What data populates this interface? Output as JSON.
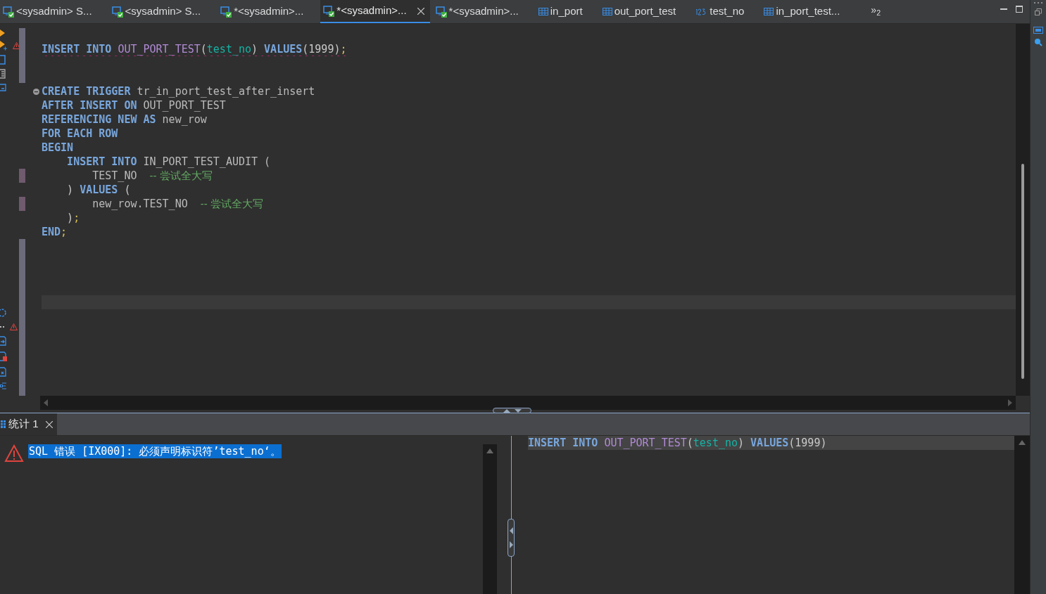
{
  "tabs": [
    {
      "label": "<sysadmin> S...",
      "kind": "script",
      "selected": false
    },
    {
      "label": "<sysadmin> S...",
      "kind": "script",
      "selected": false
    },
    {
      "label": "*<sysadmin>...",
      "kind": "script",
      "selected": false
    },
    {
      "label": "*<sysadmin>...",
      "kind": "script",
      "selected": true
    },
    {
      "label": "*<sysadmin>...",
      "kind": "script",
      "selected": false
    },
    {
      "label": "in_port",
      "kind": "table",
      "selected": false
    },
    {
      "label": "out_port_test",
      "kind": "table",
      "selected": false
    },
    {
      "label": "test_no",
      "kind": "column",
      "selected": false
    },
    {
      "label": "in_port_test...",
      "kind": "table",
      "selected": false
    }
  ],
  "overflow": "»$_{2}$",
  "editor": {
    "cursor_line_highlight": true,
    "lines": [
      {
        "kind": "code",
        "error": true,
        "tokens": [
          {
            "text": "INSERT INTO ",
            "kind": "keyword"
          },
          {
            "text": "OUT_PORT_TEST",
            "kind": "table"
          },
          {
            "text": "(",
            "kind": "punct"
          },
          {
            "text": "test_no",
            "kind": "column"
          },
          {
            "text": ") ",
            "kind": "punct"
          },
          {
            "text": "VALUES",
            "kind": "keyword"
          },
          {
            "text": "(1999)",
            "kind": "punct"
          },
          {
            "text": ";",
            "kind": "semi"
          }
        ]
      },
      {
        "kind": "blank"
      },
      {
        "kind": "blank"
      },
      {
        "kind": "code",
        "fold": true,
        "tokens": [
          {
            "text": "CREATE TRIGGER ",
            "kind": "keyword"
          },
          {
            "text": "tr_in_port_test_after_insert",
            "kind": "ident"
          }
        ]
      },
      {
        "kind": "code",
        "tokens": [
          {
            "text": "AFTER INSERT ON ",
            "kind": "keyword"
          },
          {
            "text": "OUT_PORT_TEST",
            "kind": "ident"
          }
        ]
      },
      {
        "kind": "code",
        "tokens": [
          {
            "text": "REFERENCING NEW AS ",
            "kind": "keyword"
          },
          {
            "text": "new_row",
            "kind": "ident"
          }
        ]
      },
      {
        "kind": "code",
        "tokens": [
          {
            "text": "FOR EACH ROW",
            "kind": "keyword"
          }
        ]
      },
      {
        "kind": "code",
        "tokens": [
          {
            "text": "BEGIN",
            "kind": "keyword"
          }
        ]
      },
      {
        "kind": "code",
        "tokens": [
          {
            "text": "    INSERT INTO ",
            "kind": "keyword"
          },
          {
            "text": "IN_PORT_TEST_AUDIT (",
            "kind": "ident"
          }
        ]
      },
      {
        "kind": "code",
        "changed": true,
        "tokens": [
          {
            "text": "        TEST_NO  ",
            "kind": "ident"
          },
          {
            "text": "-- 尝试全大写",
            "kind": "comment"
          }
        ]
      },
      {
        "kind": "code",
        "tokens": [
          {
            "text": "    ) ",
            "kind": "punct"
          },
          {
            "text": "VALUES",
            "kind": "keyword"
          },
          {
            "text": " (",
            "kind": "punct"
          }
        ]
      },
      {
        "kind": "code",
        "changed": true,
        "tokens": [
          {
            "text": "        new_row.TEST_NO  ",
            "kind": "ident"
          },
          {
            "text": "-- 尝试全大写",
            "kind": "comment"
          }
        ]
      },
      {
        "kind": "code",
        "tokens": [
          {
            "text": "    )",
            "kind": "punct"
          },
          {
            "text": ";",
            "kind": "semi"
          }
        ]
      },
      {
        "kind": "code",
        "tokens": [
          {
            "text": "END",
            "kind": "keyword"
          },
          {
            "text": ";",
            "kind": "semi"
          }
        ]
      }
    ]
  },
  "results": {
    "tabs": [
      {
        "label": "统计 1",
        "selected": true
      }
    ],
    "error": "SQL 错误 [IX000]: 必须声明标识符’test_no‘。",
    "query": [
      {
        "kind": "code",
        "current": true,
        "tokens": [
          {
            "text": "INSERT INTO ",
            "kind": "keyword"
          },
          {
            "text": "OUT_PORT_TEST",
            "kind": "table"
          },
          {
            "text": "(",
            "kind": "punct"
          },
          {
            "text": "test_no",
            "kind": "column"
          },
          {
            "text": ") ",
            "kind": "punct"
          },
          {
            "text": "VALUES",
            "kind": "keyword"
          },
          {
            "text": "(1999)",
            "kind": "punct"
          }
        ]
      }
    ]
  }
}
